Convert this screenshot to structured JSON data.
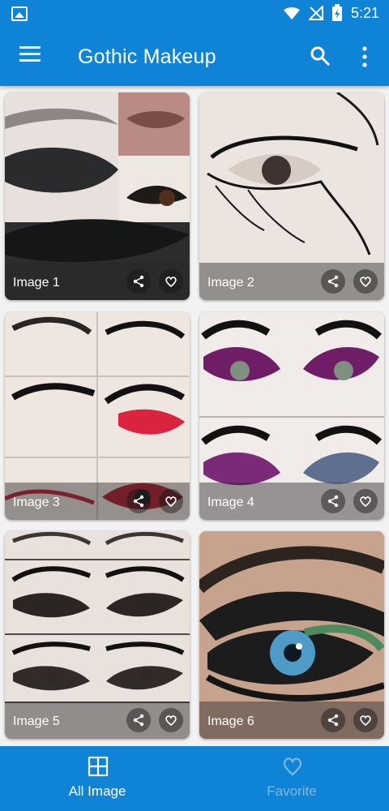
{
  "status": {
    "time": "5:21",
    "left_icon": "image-icon",
    "wifi_icon": "wifi-icon",
    "signal_icon": "signal-off-icon",
    "battery_icon": "battery-charging-icon"
  },
  "appbar": {
    "title": "Gothic Makeup",
    "menu_icon": "menu-icon",
    "search_icon": "search-icon",
    "more_icon": "more-vertical-icon"
  },
  "images": [
    {
      "label": "Image 1"
    },
    {
      "label": "Image 2"
    },
    {
      "label": "Image 3"
    },
    {
      "label": "Image 4"
    },
    {
      "label": "Image 5"
    },
    {
      "label": "Image 6"
    }
  ],
  "bottom_nav": {
    "all_image_label": "All Image",
    "favorite_label": "Favorite",
    "all_image_icon": "grid-icon",
    "favorite_icon": "heart-icon"
  },
  "colors": {
    "primary": "#0f84d6",
    "inactive_tab": "#7fb8df"
  }
}
